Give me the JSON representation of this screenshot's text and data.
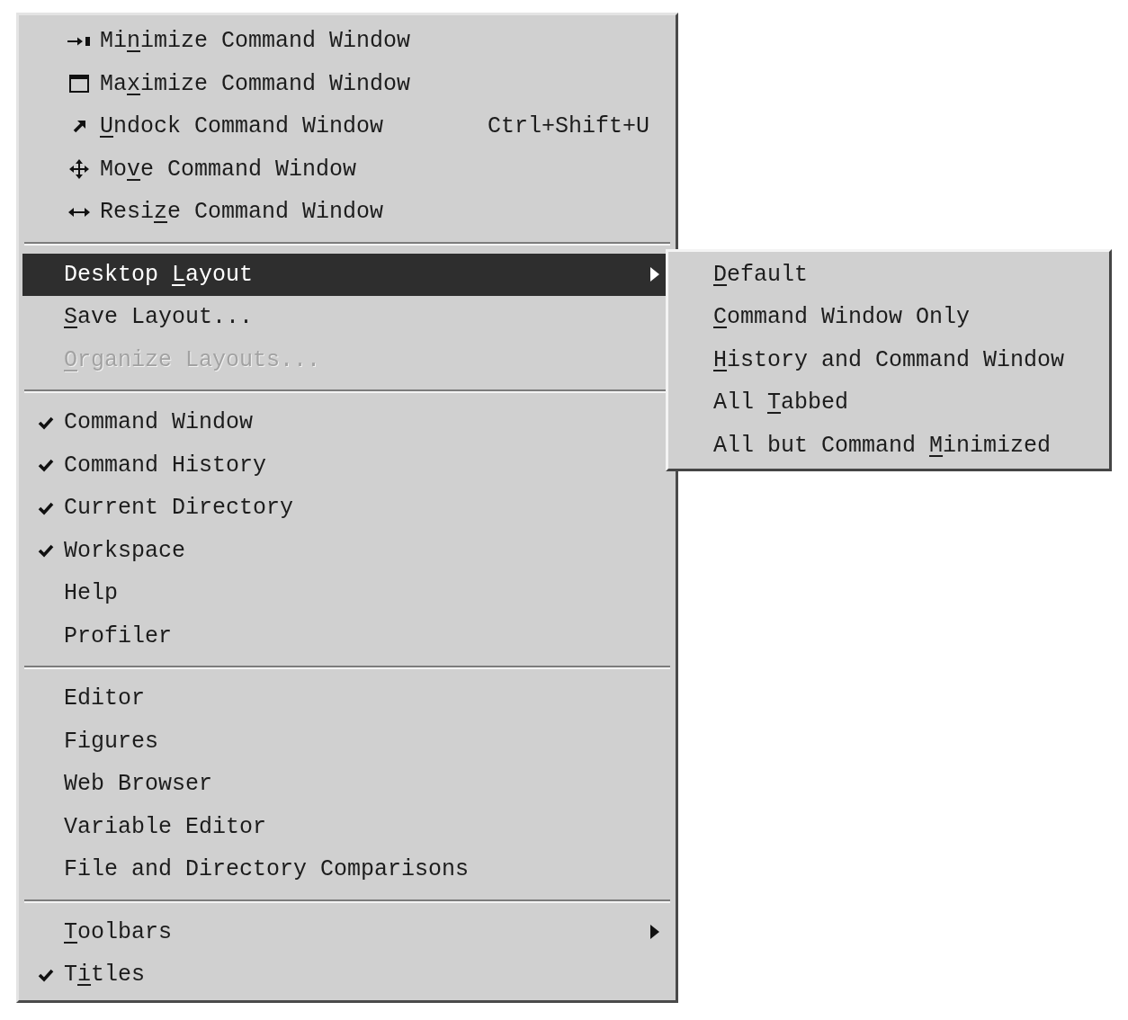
{
  "menu": {
    "groups": [
      {
        "items": [
          {
            "kind": "icon_command",
            "text_before": "Mi",
            "mnemonic": "n",
            "text_after": "imize Command Window",
            "selected": false,
            "disabled": false
          },
          {
            "kind": "icon_command",
            "text_before": "Ma",
            "mnemonic": "x",
            "text_after": "imize Command Window",
            "selected": false,
            "disabled": false
          },
          {
            "kind": "icon_command",
            "mnemonic": "U",
            "text_after": "ndock Command Window",
            "shortcut": "Ctrl+Shift+U",
            "selected": false,
            "disabled": false
          },
          {
            "kind": "icon_command",
            "text_before": "Mo",
            "mnemonic": "v",
            "text_after": "e Command Window",
            "selected": false,
            "disabled": false
          },
          {
            "kind": "icon_command",
            "text_before": "Resi",
            "mnemonic": "z",
            "text_after": "e Command Window",
            "selected": false,
            "disabled": false
          }
        ]
      },
      {
        "items": [
          {
            "kind": "submenu",
            "text_before": "Desktop ",
            "mnemonic": "L",
            "text_after": "ayout",
            "selected": true,
            "disabled": false,
            "expanded": true,
            "submenu": {
              "items": [
                {
                  "mnemonic": "D",
                  "text_after": "efault",
                  "selected": false,
                  "disabled": false
                },
                {
                  "mnemonic": "C",
                  "text_after": "ommand Window Only",
                  "selected": false,
                  "disabled": false
                },
                {
                  "mnemonic": "H",
                  "text_after": "istory and Command Window",
                  "selected": false,
                  "disabled": false
                },
                {
                  "text_before": "All ",
                  "mnemonic": "T",
                  "text_after": "abbed",
                  "selected": false,
                  "disabled": false
                },
                {
                  "text_before": "All but Command ",
                  "mnemonic": "M",
                  "text_after": "inimized",
                  "selected": false,
                  "disabled": false
                }
              ]
            }
          },
          {
            "kind": "command",
            "mnemonic": "S",
            "text_after": "ave Layout...",
            "selected": false,
            "disabled": false
          },
          {
            "kind": "command",
            "mnemonic": "O",
            "text_after": "rganize Layouts...",
            "selected": false,
            "disabled": true
          }
        ]
      },
      {
        "items": [
          {
            "kind": "toggle",
            "label": "Command Window",
            "checked": true,
            "selected": false,
            "disabled": false
          },
          {
            "kind": "toggle",
            "label": "Command History",
            "checked": true,
            "selected": false,
            "disabled": false
          },
          {
            "kind": "toggle",
            "label": "Current Directory",
            "checked": true,
            "selected": false,
            "disabled": false
          },
          {
            "kind": "toggle",
            "label": "Workspace",
            "checked": true,
            "selected": false,
            "disabled": false
          },
          {
            "kind": "toggle",
            "label": "Help",
            "checked": false,
            "selected": false,
            "disabled": false
          },
          {
            "kind": "toggle",
            "label": "Profiler",
            "checked": false,
            "selected": false,
            "disabled": false
          }
        ]
      },
      {
        "items": [
          {
            "kind": "toggle",
            "label": "Editor",
            "checked": false,
            "selected": false,
            "disabled": false
          },
          {
            "kind": "toggle",
            "label": "Figures",
            "checked": false,
            "selected": false,
            "disabled": false
          },
          {
            "kind": "toggle",
            "label": "Web Browser",
            "checked": false,
            "selected": false,
            "disabled": false
          },
          {
            "kind": "toggle",
            "label": "Variable Editor",
            "checked": false,
            "selected": false,
            "disabled": false
          },
          {
            "kind": "toggle",
            "label": "File and Directory Comparisons",
            "checked": false,
            "selected": false,
            "disabled": false
          }
        ]
      },
      {
        "items": [
          {
            "kind": "submenu",
            "mnemonic": "T",
            "text_after": "oolbars",
            "selected": false,
            "disabled": false,
            "expanded": false
          },
          {
            "kind": "toggle",
            "text_before": "T",
            "mnemonic": "i",
            "text_after": "tles",
            "checked": true,
            "selected": false,
            "disabled": false
          }
        ]
      }
    ]
  }
}
